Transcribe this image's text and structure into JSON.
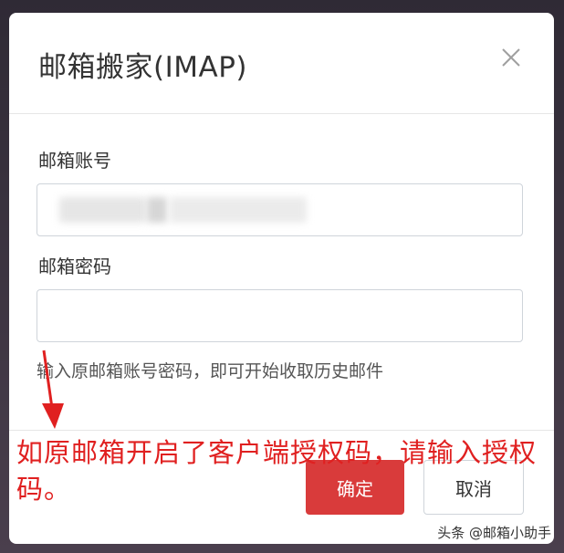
{
  "dialog": {
    "title": "邮箱搬家(IMAP)",
    "account_label": "邮箱账号",
    "password_label": "邮箱密码",
    "hint": "输入原邮箱账号密码，即可开始收取历史邮件",
    "ok_label": "确定",
    "cancel_label": "取消",
    "close_icon": "close-icon"
  },
  "annotation": {
    "text": "如原邮箱开启了客户端授权码，请输入授权码。",
    "color": "#e02020"
  },
  "watermark": {
    "text": "头条 @邮箱小助手"
  },
  "colors": {
    "primary": "#d93b3b",
    "border": "#cfd4da",
    "text": "#333333"
  }
}
